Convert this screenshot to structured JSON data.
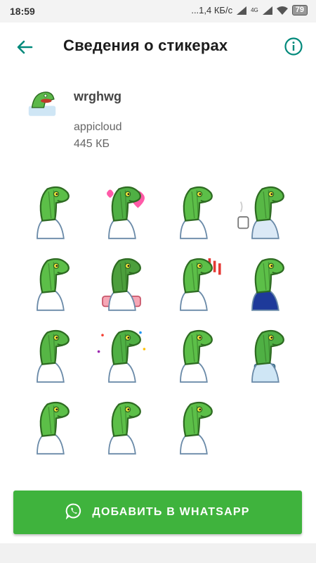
{
  "status_bar": {
    "time": "18:59",
    "network_speed": "...1,4 КБ/с",
    "network_type": "4G",
    "battery": "79"
  },
  "app_bar": {
    "title": "Сведения о стикерах",
    "back_icon": "arrow-back-icon",
    "info_icon": "info-icon",
    "accent_color": "#00897b"
  },
  "pack": {
    "name": "wrghwg",
    "publisher": "appicloud",
    "size": "445 КБ"
  },
  "stickers": [
    {
      "name": "dino-confused-sticker"
    },
    {
      "name": "dino-hearts-sticker"
    },
    {
      "name": "dino-calm-sticker"
    },
    {
      "name": "dino-coffee-sticker"
    },
    {
      "name": "dino-shrug-sticker"
    },
    {
      "name": "dino-cake-sticker"
    },
    {
      "name": "dino-shock-sticker"
    },
    {
      "name": "dino-suit-sticker"
    },
    {
      "name": "dino-relax-sticker"
    },
    {
      "name": "dino-party-sticker"
    },
    {
      "name": "dino-smirk-sticker"
    },
    {
      "name": "dino-phone-sticker"
    },
    {
      "name": "dino-idea-sticker"
    },
    {
      "name": "dino-cry-sticker"
    },
    {
      "name": "dino-think-sticker"
    }
  ],
  "add_button": {
    "label": "ДОБАВИТЬ В WHATSAPP",
    "color": "#3fb33d",
    "icon": "whatsapp-icon"
  }
}
